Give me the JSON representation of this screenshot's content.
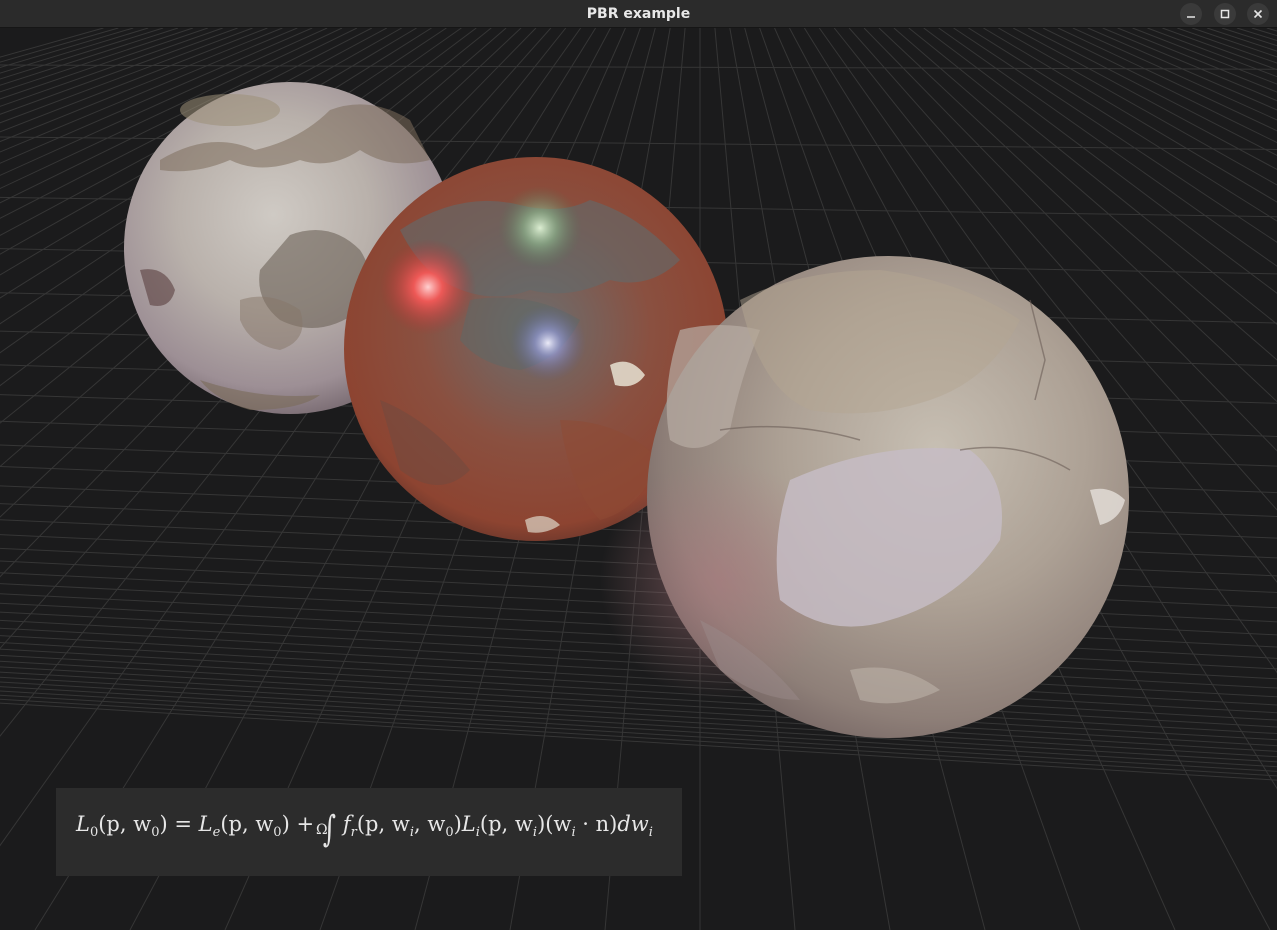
{
  "window": {
    "title": "PBR example",
    "controls": [
      "minimize-icon",
      "maximize-icon",
      "close-icon"
    ]
  },
  "formula": {
    "lhs": "L",
    "lhs_sub": "0",
    "lhs_args": "(p, w",
    "lhs_args_sub": "0",
    "lhs_args_end": ")",
    "equals": "=",
    "le": "L",
    "le_sub": "e",
    "le_args": "(p, w",
    "le_args_sub": "0",
    "le_args_end": ")",
    "plus": "+",
    "integral": "∫",
    "domain": "Ω",
    "fr": "f",
    "fr_sub": "r",
    "fr_args": "(p, w",
    "fr_args_sub1": "i",
    "fr_args_mid": ", w",
    "fr_args_sub2": "0",
    "fr_args_end": ")",
    "li": "L",
    "li_sub": "i",
    "li_args": "(p, w",
    "li_args_sub": "i",
    "li_args_end": ")",
    "dot": "(w",
    "dot_sub": "i",
    "dot_rest": " · n)",
    "dw": "dw",
    "dw_sub": "i"
  },
  "scene": {
    "background": "#1b1b1c",
    "grid_color": "#3a3a3a",
    "spheres": [
      "plaster-sphere",
      "rusted-metal-sphere",
      "peeling-paint-sphere"
    ]
  }
}
